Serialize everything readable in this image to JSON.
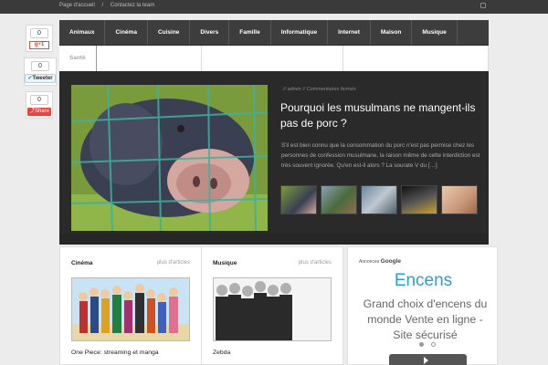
{
  "topbar": {
    "links": [
      "Page d'accueil",
      "Contactez la team"
    ]
  },
  "share": {
    "gplus_count": "0",
    "gplus_label": "g+1",
    "tweet_count": "0",
    "tweet_label": "Tweeter",
    "share_count": "0",
    "share_label": "Share"
  },
  "nav": {
    "row1": [
      "Animaux",
      "Cinéma",
      "Cuisine",
      "Divers",
      "Famille",
      "Informatique",
      "Internet",
      "Maison",
      "Musique"
    ],
    "row2": [
      "Santé"
    ]
  },
  "featured": {
    "author": "admin",
    "comments": "Commentaires fermés",
    "title": "Pourquoi les musulmans ne mangent-ils pas de porc ?",
    "excerpt": "S'il est bien connu que la consommation du porc n'est pas permise chez les personnes de confession musulmane, la raison même de cette interdiction est très souvent ignorée. Qu'en est-il alors ? La sourate V du […]"
  },
  "columns": [
    {
      "category": "Cinéma",
      "more": "plus d'articles",
      "title": "One Piece: streaming et manga"
    },
    {
      "category": "Musique",
      "more": "plus d'articles",
      "title": "Zebda"
    }
  ],
  "ad": {
    "label_prefix": "Annonces",
    "label_brand": "Google",
    "title": "Encens",
    "text": "Grand choix d'encens du monde Vente en ligne - Site sécurisé"
  },
  "colors": {
    "accent": "#2a9fd6",
    "nav_bg": "#3d3d3d",
    "featured_bg": "#2a2a2a"
  }
}
